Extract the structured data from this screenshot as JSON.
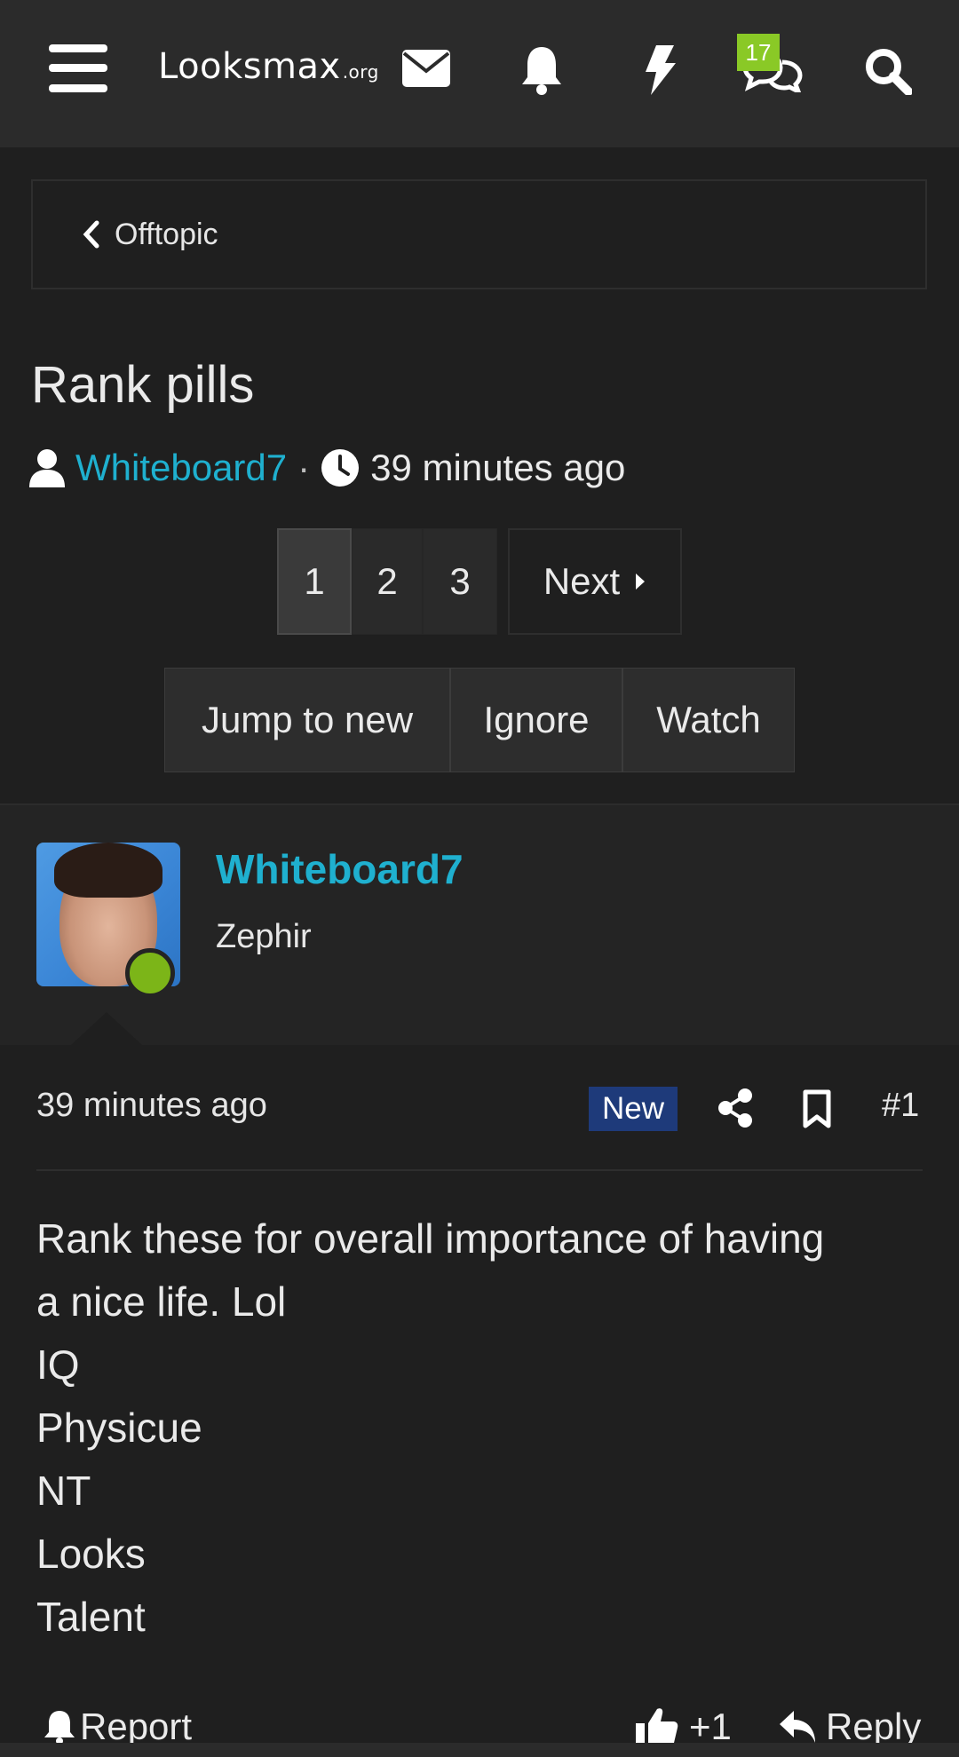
{
  "header": {
    "logo_text": "Looksmax",
    "logo_suffix": ".org",
    "conversations_badge": "17"
  },
  "breadcrumb": {
    "label": "Offtopic"
  },
  "thread": {
    "title": "Rank pills",
    "author": "Whiteboard7",
    "separator": "·",
    "time": "39 minutes ago"
  },
  "pagination": {
    "pages": [
      "1",
      "2",
      "3"
    ],
    "current": "1",
    "next_label": "Next"
  },
  "thread_actions": {
    "jump_label": "Jump to new",
    "ignore_label": "Ignore",
    "watch_label": "Watch"
  },
  "post": {
    "username": "Whiteboard7",
    "user_title": "Zephir",
    "time": "39 minutes ago",
    "new_label": "New",
    "number": "#1",
    "body_lines": [
      "Rank these for overall importance of having",
      "a nice life. Lol",
      "IQ",
      "Physicue",
      "NT",
      "Looks",
      "Talent"
    ],
    "report_label": "Report",
    "like_label": "+1",
    "reply_label": "Reply"
  },
  "colors": {
    "accent": "#1fb0cf",
    "online": "#7cb518",
    "badge": "#8ac926",
    "new_badge": "#1e3a7a"
  }
}
